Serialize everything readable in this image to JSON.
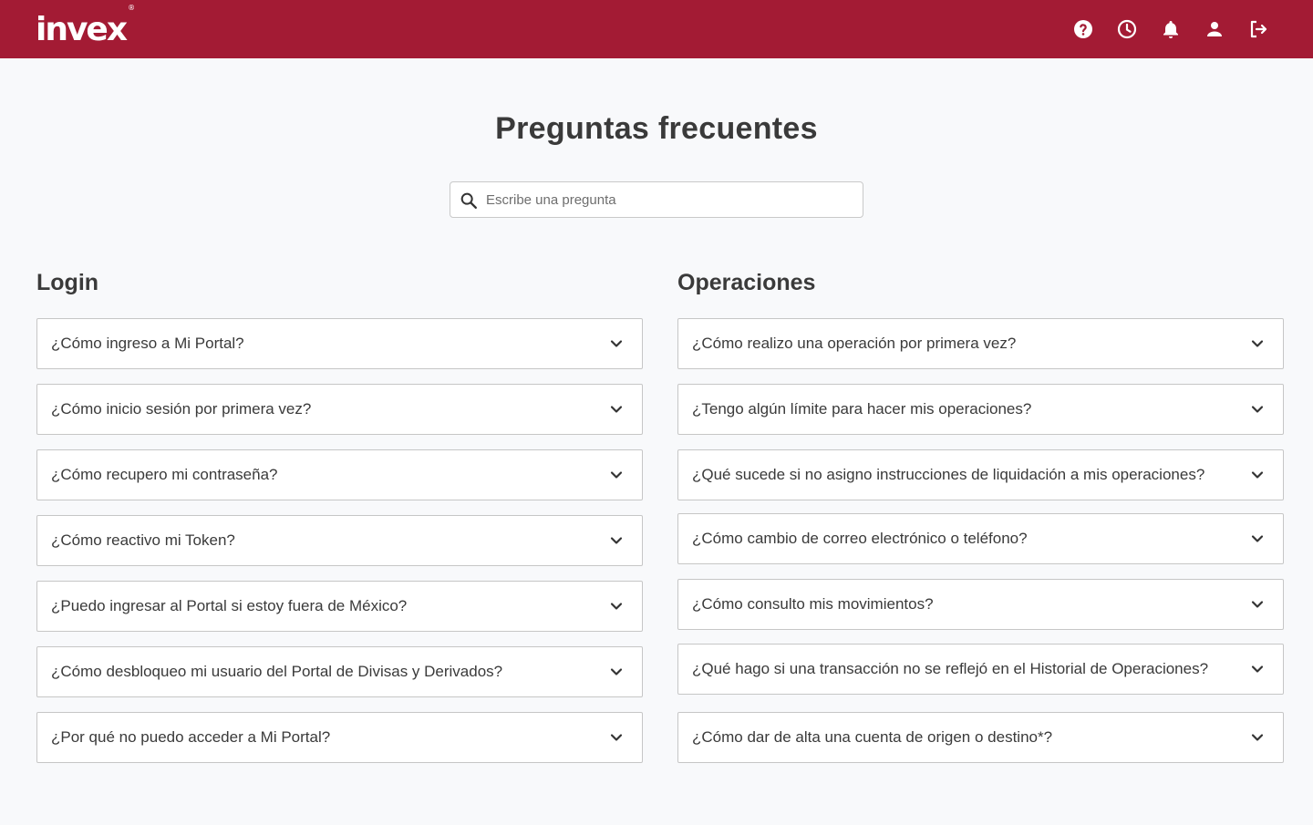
{
  "header": {
    "logo_text": "invex",
    "logo_mark": "®",
    "brand_color": "#a31b34",
    "icons": [
      "help-icon",
      "history-icon",
      "notifications-icon",
      "user-icon",
      "logout-icon"
    ]
  },
  "main": {
    "title": "Preguntas frecuentes",
    "search": {
      "placeholder": "Escribe una pregunta",
      "value": "",
      "icon": "search-icon"
    }
  },
  "sections": {
    "login": {
      "title": "Login",
      "items": [
        "¿Cómo ingreso a Mi Portal?",
        "¿Cómo inicio sesión por primera vez?",
        "¿Cómo recupero mi contraseña?",
        "¿Cómo reactivo mi Token?",
        "¿Puedo ingresar al Portal si estoy fuera de México?",
        "¿Cómo desbloqueo mi usuario del Portal de Divisas y Derivados?",
        "¿Por qué no puedo acceder a Mi Portal?"
      ]
    },
    "operaciones": {
      "title": "Operaciones",
      "items": [
        "¿Cómo realizo una operación por primera vez?",
        "¿Tengo algún límite para hacer mis operaciones?",
        "¿Qué sucede si no asigno instrucciones de liquidación a mis operaciones?",
        "¿Cómo cambio de correo electrónico o teléfono?",
        "¿Cómo consulto mis movimientos?",
        "¿Qué hago si una transacción no se reflejó en el Historial de Operaciones?",
        "¿Cómo dar de alta una cuenta de origen o destino*?"
      ]
    }
  }
}
